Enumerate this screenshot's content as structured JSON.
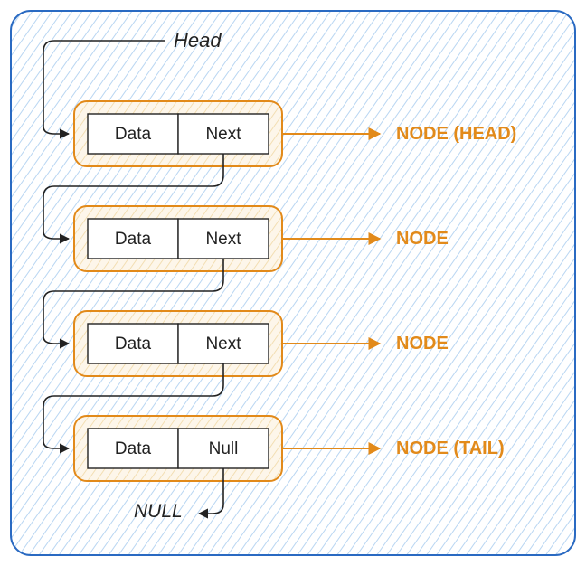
{
  "colors": {
    "hatch": "#b9d6f2",
    "node_fill": "#fdf6ea",
    "node_hatch": "#f0d9a6",
    "node_border": "#e28a1a",
    "arrow_orange": "#e28a1a",
    "arrow_black": "#222222",
    "outer_border": "#2a6ac2"
  },
  "head_label": "Head",
  "null_label": "NULL",
  "nodes": [
    {
      "data": "Data",
      "next": "Next",
      "annotation": "NODE (HEAD)"
    },
    {
      "data": "Data",
      "next": "Next",
      "annotation": "NODE"
    },
    {
      "data": "Data",
      "next": "Next",
      "annotation": "NODE"
    },
    {
      "data": "Data",
      "next": "Null",
      "annotation": "NODE (TAIL)"
    }
  ]
}
